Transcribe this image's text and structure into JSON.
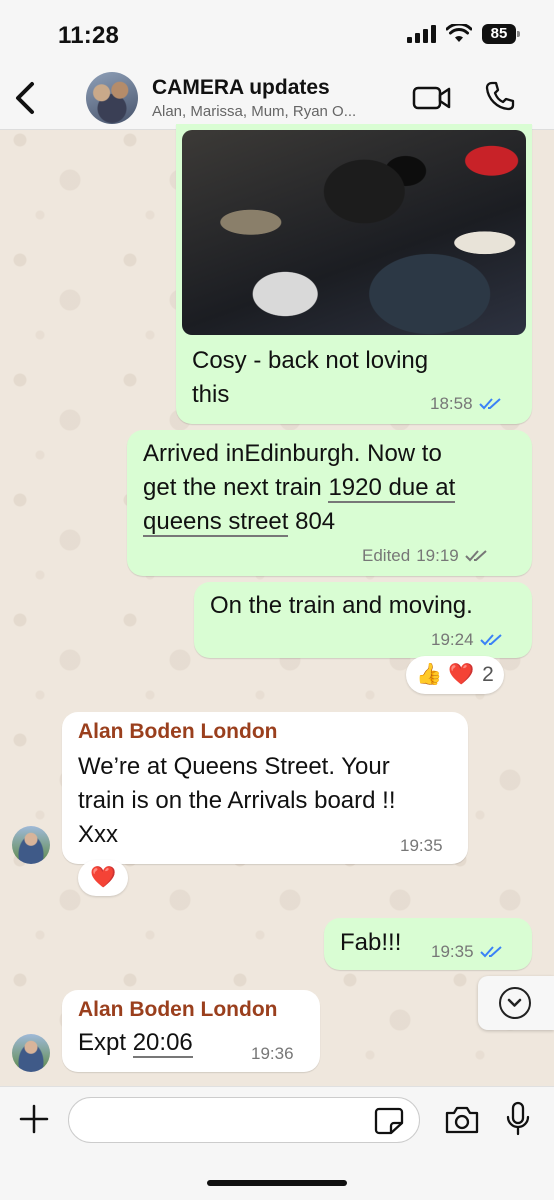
{
  "status_bar": {
    "time": "11:28",
    "battery": "85"
  },
  "header": {
    "title": "CAMERA updates",
    "subtitle": "Alan, Marissa, Mum, Ryan O..."
  },
  "messages": [
    {
      "type": "outgoing",
      "text_lines": [
        "Cosy - back not loving",
        "this"
      ],
      "time": "18:58",
      "status": "read"
    },
    {
      "type": "outgoing",
      "line1": "Arrived inEdinburgh.  Now to",
      "line2_pre": "get the next train ",
      "line2_link": "1920 due at",
      "line3_link": "queens street",
      "line3_post": " 804",
      "edited": "Edited",
      "time": "19:19",
      "status": "delivered"
    },
    {
      "type": "outgoing",
      "text": "On the train and moving.",
      "time": "19:24",
      "status": "read",
      "reactions": {
        "emojis": "👍 ❤️",
        "count": "2"
      }
    },
    {
      "type": "incoming",
      "sender": "Alan Boden London",
      "text_lines": [
        "We’re at Queens Street. Your",
        "train is on the Arrivals board !!",
        "Xxx"
      ],
      "time": "19:35",
      "reaction": "❤️"
    },
    {
      "type": "outgoing",
      "text": "Fab!!!",
      "time": "19:35",
      "status": "read"
    },
    {
      "type": "incoming",
      "sender": "Alan Boden London",
      "text_pre": "Expt ",
      "text_link": "20:06",
      "time": "19:36"
    }
  ],
  "input": {
    "placeholder": ""
  },
  "colors": {
    "outgoing_bubble": "#d9fdd3",
    "incoming_bubble": "#ffffff",
    "sender_name": "#9a3f1d",
    "read_ticks": "#3b82f6"
  },
  "icons": [
    "back-chevron-icon",
    "video-call-icon",
    "phone-icon",
    "scroll-down-icon",
    "plus-icon",
    "sticker-icon",
    "camera-icon",
    "mic-icon"
  ]
}
